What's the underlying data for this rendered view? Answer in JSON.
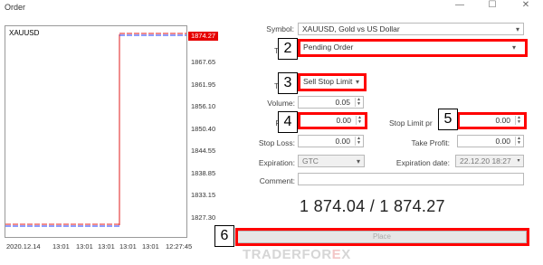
{
  "window": {
    "title": "Order",
    "minimize": "—",
    "maximize": "☐",
    "close": "✕"
  },
  "chart": {
    "symbol_label": "XAUUSD",
    "current_price_tag": "1874.27",
    "y_ticks": [
      "1867.65",
      "1861.95",
      "1856.10",
      "1850.40",
      "1844.55",
      "1838.85",
      "1833.15",
      "1827.30"
    ],
    "x_ticks": [
      "2020.12.14",
      "13:01",
      "13:01",
      "13:01",
      "13:01",
      "13:01",
      "12:27:45"
    ],
    "colors": {
      "bid": "#1f3cff",
      "ask": "#e01b1b",
      "price_tag": "#e60000"
    }
  },
  "form": {
    "symbol_label": "Symbol:",
    "symbol_value": "XAUUSD, Gold vs US Dollar",
    "type_label": "Ty",
    "type_value": "Pending Order",
    "subtype_label": "Ty",
    "subtype_value": "Sell Stop Limit",
    "volume_label": "Volume:",
    "volume_value": "0.05",
    "price_label": "P",
    "price_value": "0.00",
    "stop_limit_label": "Stop Limit pr",
    "stop_limit_value": "0.00",
    "stop_loss_label": "Stop Loss:",
    "stop_loss_value": "0.00",
    "take_profit_label": "Take Profit:",
    "take_profit_value": "0.00",
    "expiration_label": "Expiration:",
    "expiration_value": "GTC",
    "expiration_date_label": "Expiration date:",
    "expiration_date_value": "22.12.20 18:27",
    "comment_label": "Comment:",
    "comment_value": ""
  },
  "quote": {
    "text": "1 874.04 / 1 874.27"
  },
  "place_button": "Place",
  "callouts": [
    "2",
    "3",
    "4",
    "5",
    "6"
  ],
  "watermark": {
    "left": "TRADER",
    "right": "FOR",
    "x": "E",
    "end": "X"
  }
}
